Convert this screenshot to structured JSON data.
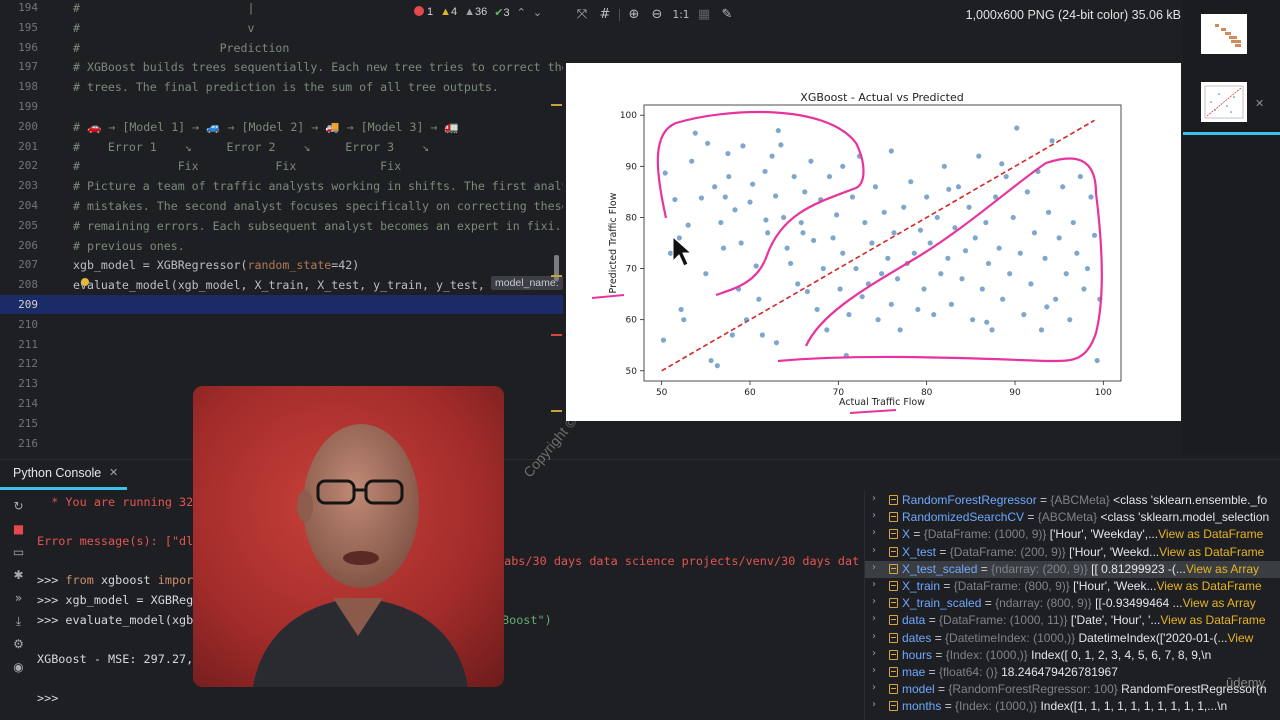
{
  "editor": {
    "badges": {
      "errors": "1",
      "warnings": "4",
      "weak": "36",
      "ok": "3"
    },
    "lines": [
      {
        "n": "194",
        "text": "#                        |"
      },
      {
        "n": "195",
        "text": "#                        v"
      },
      {
        "n": "196",
        "text": "#                    Prediction"
      },
      {
        "n": "197",
        "text": "# XGBoost builds trees sequentially. Each new tree tries to correct the"
      },
      {
        "n": "198",
        "text": "# trees. The final prediction is the sum of all tree outputs."
      },
      {
        "n": "199",
        "text": ""
      },
      {
        "n": "200",
        "text": "# 🚗 → [Model 1] → 🚙 → [Model 2] → 🚚 → [Model 3] → 🚛"
      },
      {
        "n": "201",
        "text": "#    Error 1    ↘     Error 2    ↘     Error 3    ↘"
      },
      {
        "n": "202",
        "text": "#              Fix           Fix            Fix"
      },
      {
        "n": "203",
        "text": "# Picture a team of traffic analysts working in shifts. The first analy"
      },
      {
        "n": "204",
        "text": "# mistakes. The second analyst focuses specifically on correcting these"
      },
      {
        "n": "205",
        "text": "# remaining errors. Each subsequent analyst becomes an expert in fixi..."
      },
      {
        "n": "206",
        "text": "# previous ones."
      },
      {
        "n": "207",
        "code": true,
        "pre": "xgb_model = XGBRegressor(",
        "param": "random_state",
        "post": "=42)"
      },
      {
        "n": "208",
        "code": true,
        "pre": "evaluate_model(xgb_model, X_train, X_test, y_train, y_test, ",
        "param": "",
        "post": ""
      },
      {
        "n": "209",
        "text": ""
      },
      {
        "n": "210",
        "text": ""
      },
      {
        "n": "211",
        "text": ""
      },
      {
        "n": "212",
        "text": ""
      },
      {
        "n": "213",
        "text": ""
      },
      {
        "n": "214",
        "text": ""
      },
      {
        "n": "215",
        "text": ""
      },
      {
        "n": "216",
        "text": ""
      }
    ],
    "hint": "model_name:"
  },
  "viewer": {
    "info": "1,000x600 PNG (24-bit color) 35.06 kB",
    "zoom_label": "1:1"
  },
  "chart_data": {
    "type": "scatter",
    "title": "XGBoost - Actual vs Predicted",
    "xlabel": "Actual Traffic Flow",
    "ylabel": "Predicted Traffic Flow",
    "xlim": [
      48,
      102
    ],
    "ylim": [
      48,
      102
    ],
    "xticks": [
      50,
      60,
      70,
      80,
      90,
      100
    ],
    "yticks": [
      50,
      60,
      70,
      80,
      90,
      100
    ],
    "point_color": "#3b78b1",
    "reference_line": {
      "from": [
        50,
        50
      ],
      "to": [
        99,
        99
      ],
      "color": "#d62728",
      "style": "dashed"
    },
    "points": [
      [
        50.2,
        56
      ],
      [
        50.4,
        88.7
      ],
      [
        51,
        73
      ],
      [
        51.5,
        83.5
      ],
      [
        52,
        76
      ],
      [
        52.5,
        60
      ],
      [
        53,
        78.5
      ],
      [
        53.4,
        91
      ],
      [
        53.8,
        96.5
      ],
      [
        54.5,
        83.8
      ],
      [
        55,
        69
      ],
      [
        55.2,
        94.5
      ],
      [
        55.6,
        52
      ],
      [
        56,
        86
      ],
      [
        56.3,
        51
      ],
      [
        56.7,
        79
      ],
      [
        57,
        74
      ],
      [
        57.2,
        84
      ],
      [
        57.6,
        88
      ],
      [
        58,
        57
      ],
      [
        58.3,
        81.5
      ],
      [
        58.7,
        66
      ],
      [
        59,
        75
      ],
      [
        59.2,
        94
      ],
      [
        59.6,
        60
      ],
      [
        60,
        83
      ],
      [
        60.3,
        86.5
      ],
      [
        60.7,
        70.5
      ],
      [
        61,
        64
      ],
      [
        61.4,
        57
      ],
      [
        61.7,
        89
      ],
      [
        62,
        77
      ],
      [
        62.5,
        92
      ],
      [
        62.9,
        84.2
      ],
      [
        63.2,
        97
      ],
      [
        63.5,
        94.2
      ],
      [
        63.8,
        80
      ],
      [
        64.2,
        74
      ],
      [
        64.6,
        71
      ],
      [
        65,
        88
      ],
      [
        65.4,
        67
      ],
      [
        65.8,
        79
      ],
      [
        66.2,
        85
      ],
      [
        66.5,
        65.5
      ],
      [
        66.9,
        91
      ],
      [
        67.2,
        75.5
      ],
      [
        67.6,
        62
      ],
      [
        68,
        83.5
      ],
      [
        68.3,
        70
      ],
      [
        68.7,
        58
      ],
      [
        69,
        88
      ],
      [
        69.4,
        76
      ],
      [
        69.8,
        80.5
      ],
      [
        70.2,
        66
      ],
      [
        70.5,
        73
      ],
      [
        70.9,
        53
      ],
      [
        71.2,
        61
      ],
      [
        71.6,
        84
      ],
      [
        72,
        70
      ],
      [
        72.4,
        92
      ],
      [
        72.7,
        64.5
      ],
      [
        73,
        79
      ],
      [
        73.4,
        67
      ],
      [
        73.8,
        75
      ],
      [
        74.2,
        86
      ],
      [
        74.5,
        60
      ],
      [
        74.9,
        69
      ],
      [
        75.2,
        81
      ],
      [
        75.6,
        72
      ],
      [
        76,
        63
      ],
      [
        76.3,
        77
      ],
      [
        76.7,
        68
      ],
      [
        77,
        58
      ],
      [
        77.4,
        82
      ],
      [
        77.8,
        71
      ],
      [
        78.2,
        87
      ],
      [
        78.6,
        73
      ],
      [
        79,
        62
      ],
      [
        79.3,
        77.5
      ],
      [
        79.7,
        66
      ],
      [
        80,
        84
      ],
      [
        80.4,
        75
      ],
      [
        80.8,
        61
      ],
      [
        81.2,
        80
      ],
      [
        81.6,
        69
      ],
      [
        82,
        90
      ],
      [
        82.4,
        72
      ],
      [
        82.8,
        63
      ],
      [
        83.2,
        78
      ],
      [
        83.6,
        86
      ],
      [
        84,
        68
      ],
      [
        84.4,
        73.5
      ],
      [
        84.8,
        82
      ],
      [
        85.2,
        60
      ],
      [
        85.5,
        76
      ],
      [
        85.9,
        92
      ],
      [
        86.3,
        66
      ],
      [
        86.7,
        79
      ],
      [
        87,
        71
      ],
      [
        87.4,
        58
      ],
      [
        87.8,
        84
      ],
      [
        88.2,
        74
      ],
      [
        88.6,
        64
      ],
      [
        89,
        88
      ],
      [
        89.4,
        69
      ],
      [
        89.8,
        80
      ],
      [
        90.2,
        97.5
      ],
      [
        90.6,
        73
      ],
      [
        91,
        61
      ],
      [
        91.4,
        85
      ],
      [
        91.8,
        67
      ],
      [
        92.2,
        77
      ],
      [
        92.6,
        89
      ],
      [
        93,
        58
      ],
      [
        93.4,
        72
      ],
      [
        93.8,
        81
      ],
      [
        94.2,
        95
      ],
      [
        94.6,
        64
      ],
      [
        95,
        76
      ],
      [
        95.4,
        86
      ],
      [
        95.8,
        69
      ],
      [
        96.2,
        60
      ],
      [
        96.6,
        79
      ],
      [
        97,
        73
      ],
      [
        97.4,
        88
      ],
      [
        97.8,
        66
      ],
      [
        98.2,
        70
      ],
      [
        98.6,
        84
      ],
      [
        99,
        76.5
      ],
      [
        99.3,
        52
      ],
      [
        99.6,
        64
      ],
      [
        52.2,
        62
      ],
      [
        61.8,
        79.5
      ],
      [
        63,
        55.5
      ],
      [
        86.8,
        59.5
      ],
      [
        93.6,
        62.5
      ],
      [
        57.5,
        92.5
      ],
      [
        66,
        77
      ],
      [
        76,
        93
      ],
      [
        82.5,
        85.5
      ],
      [
        70.5,
        90
      ],
      [
        88.5,
        90.5
      ]
    ]
  },
  "console": {
    "tab_label": "Python Console",
    "lines": [
      {
        "type": "err",
        "text": "  * You are running 32-"
      },
      {
        "type": "blank",
        "text": ""
      },
      {
        "type": "err",
        "text": "Error message(s): [\"dl"
      },
      {
        "type": "err_tail",
        "text": "labs/30 days data science projects/venv/30 days dat"
      },
      {
        "type": "prompt_kw",
        "pre": ">>> ",
        "kw1": "from",
        "mid": " xgboost ",
        "kw2": "impor",
        "post": ""
      },
      {
        "type": "prompt",
        "text": ">>> xgb_model = XGBRegr"
      },
      {
        "type": "prompt",
        "text": ">>> evaluate_model(xgb_"
      },
      {
        "type": "str_tail",
        "text": "Boost\")"
      },
      {
        "type": "out",
        "text": "XGBoost - MSE: 297.27,"
      },
      {
        "type": "blank",
        "text": ""
      },
      {
        "type": "prompt",
        "text": ">>>"
      }
    ]
  },
  "variables": [
    {
      "name": "RandomForestRegressor",
      "type": "{ABCMeta}",
      "value": "<class 'sklearn.ensemble._fo",
      "link": "",
      "sel": false
    },
    {
      "name": "RandomizedSearchCV",
      "type": "{ABCMeta}",
      "value": "<class 'sklearn.model_selection",
      "link": "",
      "sel": false
    },
    {
      "name": "X",
      "type": "{DataFrame: (1000, 9)}",
      "value": "['Hour', 'Weekday',...",
      "link": "View as DataFrame",
      "sel": false
    },
    {
      "name": "X_test",
      "type": "{DataFrame: (200, 9)}",
      "value": "['Hour', 'Weekd...",
      "link": "View as DataFrame",
      "sel": false
    },
    {
      "name": "X_test_scaled",
      "type": "{ndarray: (200, 9)}",
      "value": "[[ 0.81299923 -(...",
      "link": "View as Array",
      "sel": true
    },
    {
      "name": "X_train",
      "type": "{DataFrame: (800, 9)}",
      "value": "['Hour', 'Week...",
      "link": "View as DataFrame",
      "sel": false
    },
    {
      "name": "X_train_scaled",
      "type": "{ndarray: (800, 9)}",
      "value": "[[-0.93499464 ...",
      "link": "View as Array",
      "sel": false
    },
    {
      "name": "data",
      "type": "{DataFrame: (1000, 11)}",
      "value": "['Date', 'Hour', '...",
      "link": "View as DataFrame",
      "sel": false
    },
    {
      "name": "dates",
      "type": "{DatetimeIndex: (1000,)}",
      "value": "DatetimeIndex(['2020-01-(...",
      "link": "View",
      "sel": false
    },
    {
      "name": "hours",
      "type": "{Index: (1000,)}",
      "value": "Index([ 0,  1,  2,  3,  4,  5,  6,  7,  8,  9,\\n",
      "link": "",
      "sel": false
    },
    {
      "name": "mae",
      "type": "{float64: ()}",
      "value": "18.246479426781967",
      "link": "",
      "sel": false
    },
    {
      "name": "model",
      "type": "{RandomForestRegressor: 100}",
      "value": "RandomForestRegressor(n",
      "link": "",
      "sel": false
    },
    {
      "name": "months",
      "type": "{Index: (1000,)}",
      "value": "Index([1, 1, 1, 1, 1, 1, 1, 1, 1, 1,...\\n",
      "link": "",
      "sel": false
    }
  ],
  "watermark": "Copyright © 2025",
  "udemy": "ûdemy"
}
